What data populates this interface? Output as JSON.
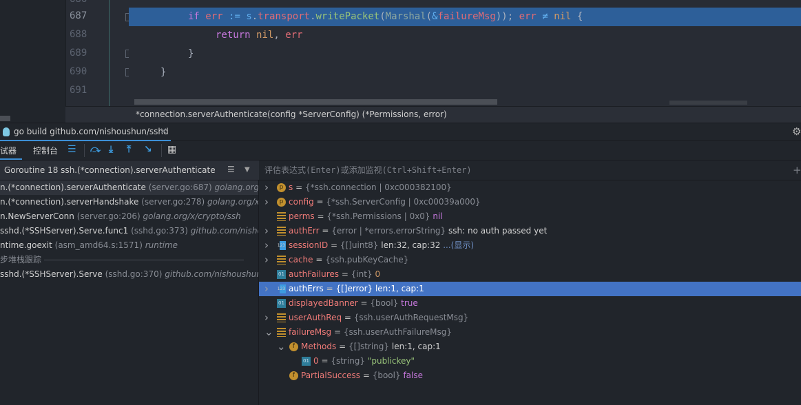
{
  "editor": {
    "lines": [
      {
        "num": "686"
      },
      {
        "num": "687",
        "highlighted": true
      },
      {
        "num": "688"
      },
      {
        "num": "689"
      },
      {
        "num": "690"
      },
      {
        "num": "691"
      }
    ],
    "breadcrumb": "*connection.serverAuthenticate(config *ServerConfig) (*Permissions, error)"
  },
  "run_tab": {
    "label": "go build github.com/nishoushun/sshd",
    "close": "×"
  },
  "toolbar": {
    "debugger_tab": "试器",
    "console_tab": "控制台"
  },
  "frames": {
    "goroutine": "Goroutine 18 ssh.(*connection).serverAuthenticate",
    "items": [
      {
        "fn": "n.(*connection).serverAuthenticate",
        "loc": "(server.go:687)",
        "pkg": "golang.org/x/"
      },
      {
        "fn": "n.(*connection).serverHandshake",
        "loc": "(server.go:278)",
        "pkg": "golang.org/x/c"
      },
      {
        "fn": "n.NewServerConn",
        "loc": "(server.go:206)",
        "pkg": "golang.org/x/crypto/ssh"
      },
      {
        "fn": "sshd.(*SSHServer).Serve.func1",
        "loc": "(sshd.go:373)",
        "pkg": "github.com/nishou"
      },
      {
        "fn": "ntime.goexit",
        "loc": "(asm_amd64.s:1571)",
        "pkg": "runtime"
      }
    ],
    "async_label": "步堆栈跟踪",
    "async_items": [
      {
        "fn": "sshd.(*SSHServer).Serve",
        "loc": "(sshd.go:370)",
        "pkg": "github.com/nishoushun/"
      }
    ]
  },
  "eval": {
    "placeholder": "评估表达式(Enter)或添加监视(Ctrl+Shift+Enter)"
  },
  "variables": [
    {
      "name": "s",
      "type": "{*ssh.connection | 0xc000382100}",
      "value": "",
      "icon": "p",
      "expand": ">",
      "indent": 0
    },
    {
      "name": "config",
      "type": "{*ssh.ServerConfig | 0xc00039a000}",
      "value": "",
      "icon": "p",
      "expand": ">",
      "indent": 0
    },
    {
      "name": "perms",
      "type": "{*ssh.Permissions | 0x0}",
      "value": "nil",
      "vclass": "nil",
      "icon": "st",
      "expand": "",
      "indent": 0
    },
    {
      "name": "authErr",
      "type": "{error | *errors.errorString}",
      "value": "ssh: no auth passed yet",
      "icon": "st",
      "expand": ">",
      "indent": 0
    },
    {
      "name": "sessionID",
      "type": "{[]uint8}",
      "value": "len:32, cap:32",
      "extra": "...(显示)",
      "icon": "arr",
      "expand": ">",
      "indent": 0
    },
    {
      "name": "cache",
      "type": "{ssh.pubKeyCache}",
      "value": "",
      "icon": "st",
      "expand": ">",
      "indent": 0
    },
    {
      "name": "authFailures",
      "type": "{int}",
      "value": "0",
      "vclass": "num",
      "icon": "n",
      "expand": "",
      "indent": 0
    },
    {
      "name": "authErrs",
      "type": "{[]error}",
      "value": "len:1, cap:1",
      "icon": "arr",
      "expand": ">",
      "indent": 0,
      "selected": true
    },
    {
      "name": "displayedBanner",
      "type": "{bool}",
      "value": "true",
      "vclass": "nil",
      "icon": "n",
      "expand": "",
      "indent": 0
    },
    {
      "name": "userAuthReq",
      "type": "{ssh.userAuthRequestMsg}",
      "value": "",
      "icon": "st",
      "expand": ">",
      "indent": 0
    },
    {
      "name": "failureMsg",
      "type": "{ssh.userAuthFailureMsg}",
      "value": "",
      "icon": "st",
      "expand": "v",
      "indent": 0
    },
    {
      "name": "Methods",
      "type": "{[]string}",
      "value": "len:1, cap:1",
      "icon": "f",
      "expand": "v",
      "indent": 1
    },
    {
      "name": "0",
      "type": "{string}",
      "value": "\"publickey\"",
      "vclass": "str",
      "icon": "n",
      "expand": "",
      "indent": 2
    },
    {
      "name": "PartialSuccess",
      "type": "{bool}",
      "value": "false",
      "vclass": "nil",
      "icon": "f",
      "expand": "",
      "indent": 1
    }
  ],
  "colors": {
    "highlight": "#2d5f99",
    "selection": "#4373c4",
    "accent": "#3d8fd6"
  }
}
